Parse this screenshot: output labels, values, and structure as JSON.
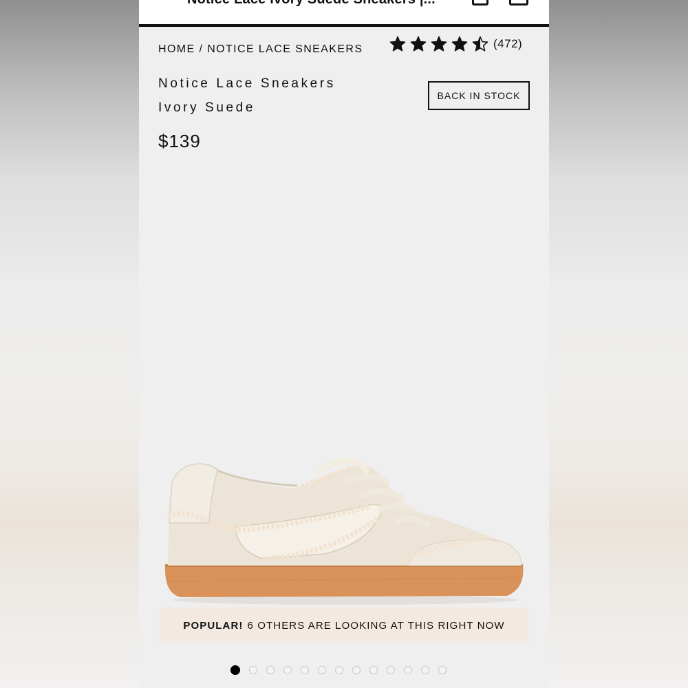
{
  "topbar": {
    "title": "Notice Lace Ivory Suede Sneakers |..."
  },
  "breadcrumb": {
    "home": "HOME",
    "separator": "/",
    "current": "NOTICE LACE SNEAKERS"
  },
  "rating": {
    "value": 4.5,
    "max": 5,
    "count_label": "(472)"
  },
  "product": {
    "title_line1": "Notice Lace Sneakers",
    "title_line2": "Ivory Suede",
    "price": "$139",
    "stock_button": "BACK IN STOCK"
  },
  "banner": {
    "bold": "POPULAR!",
    "text": "6 OTHERS ARE LOOKING AT THIS RIGHT NOW"
  },
  "carousel": {
    "total": 13,
    "active_index": 0
  },
  "colors": {
    "text": "#111111",
    "page_bg": "#efefef",
    "banner_bg": "#f3e9e1",
    "sole": "#d9935a",
    "upper": "#ece4d6"
  }
}
